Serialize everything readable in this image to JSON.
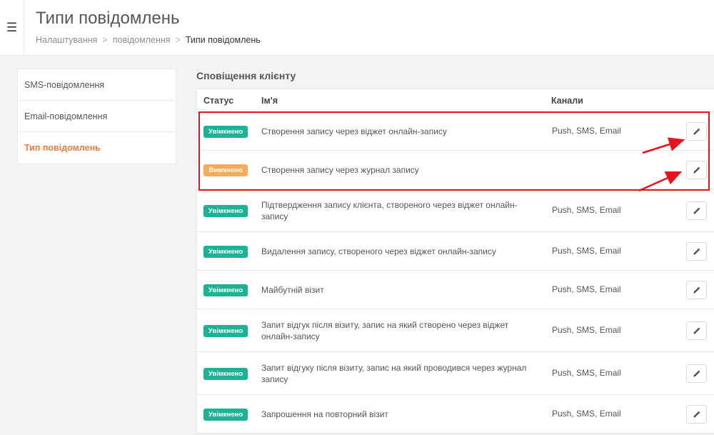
{
  "header": {
    "menu_icon": "hamburger-icon",
    "title": "Типи повідомлень",
    "breadcrumb": [
      "Налаштування",
      "повідомлення",
      "Типи повідомлень"
    ],
    "breadcrumb_sep": ">"
  },
  "sidebar": {
    "items": [
      {
        "label": "SMS-повідомлення",
        "active": false
      },
      {
        "label": "Email-повідомлення",
        "active": false
      },
      {
        "label": "Тип повідомлень",
        "active": true
      }
    ]
  },
  "section": {
    "title": "Сповіщення клієнту",
    "columns": {
      "status": "Статус",
      "name": "Ім'я",
      "channels": "Канали"
    },
    "rows": [
      {
        "status": "Увімкнено",
        "status_type": "on",
        "name": "Створення запису через віджет онлайн-запису",
        "channels": "Push, SMS, Email"
      },
      {
        "status": "Вимкнено",
        "status_type": "off",
        "name": "Створення запису через журнал запису",
        "channels": ""
      },
      {
        "status": "Увімкнено",
        "status_type": "on",
        "name": "Підтвердження запису клієнта, створеного через віджет онлайн-запису",
        "channels": "Push, SMS, Email"
      },
      {
        "status": "Увімкнено",
        "status_type": "on",
        "name": "Видалення запису, створеного через віджет онлайн-запису",
        "channels": "Push, SMS, Email"
      },
      {
        "status": "Увімкнено",
        "status_type": "on",
        "name": "Майбутній візит",
        "channels": "Push, SMS, Email"
      },
      {
        "status": "Увімкнено",
        "status_type": "on",
        "name": "Запит відгук після візиту, запис на який створено через віджет онлайн-запису",
        "channels": "Push, SMS, Email"
      },
      {
        "status": "Увімкнено",
        "status_type": "on",
        "name": "Запит відгуку після візиту, запис на який проводився через журнал запису",
        "channels": "Push, SMS, Email"
      },
      {
        "status": "Увімкнено",
        "status_type": "on",
        "name": "Запрошення на повторний візит",
        "channels": "Push, SMS, Email"
      }
    ],
    "edit_icon": "pencil-icon"
  },
  "colors": {
    "enabled_badge": "#1ab394",
    "disabled_badge": "#f8ac59",
    "active_sidebar": "#ef7c3e",
    "annotation": "#e8141b"
  }
}
